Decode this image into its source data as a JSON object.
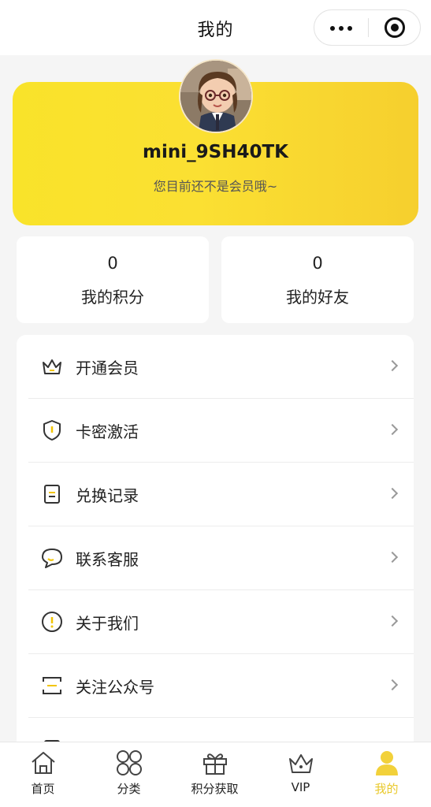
{
  "header": {
    "title": "我的",
    "more_icon": "more-dots-icon",
    "close_icon": "target-close-icon"
  },
  "profile": {
    "username": "mini_9SH40TK",
    "member_tip": "您目前还不是会员哦~",
    "card_color": "#fbe032"
  },
  "stats": [
    {
      "value": "0",
      "label": "我的积分"
    },
    {
      "value": "0",
      "label": "我的好友"
    }
  ],
  "menu": [
    {
      "label": "开通会员",
      "icon": "crown-icon"
    },
    {
      "label": "卡密激活",
      "icon": "shield-icon"
    },
    {
      "label": "兑换记录",
      "icon": "record-icon"
    },
    {
      "label": "联系客服",
      "icon": "chat-bubble-icon"
    },
    {
      "label": "关于我们",
      "icon": "info-circle-icon"
    },
    {
      "label": "关注公众号",
      "icon": "scan-frame-icon"
    }
  ],
  "tabbar": {
    "active_color": "#e9c92c",
    "items": [
      {
        "label": "首页",
        "icon": "home-icon"
      },
      {
        "label": "分类",
        "icon": "grid-circles-icon"
      },
      {
        "label": "积分获取",
        "icon": "gift-icon"
      },
      {
        "label": "VIP",
        "icon": "crown-icon"
      },
      {
        "label": "我的",
        "icon": "user-icon"
      }
    ]
  }
}
